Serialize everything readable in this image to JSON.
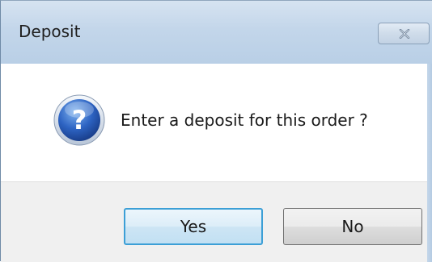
{
  "window": {
    "title": "Deposit"
  },
  "dialog": {
    "icon": "question-icon",
    "message": "Enter a deposit for this order ?"
  },
  "buttons": {
    "yes_label": "Yes",
    "no_label": "No"
  },
  "colors": {
    "titlebar": "#c3d6ea",
    "icon_blue": "#2a5fb5",
    "focused_button_border": "#3c9fd6",
    "footer_bg": "#f0f0f0"
  }
}
